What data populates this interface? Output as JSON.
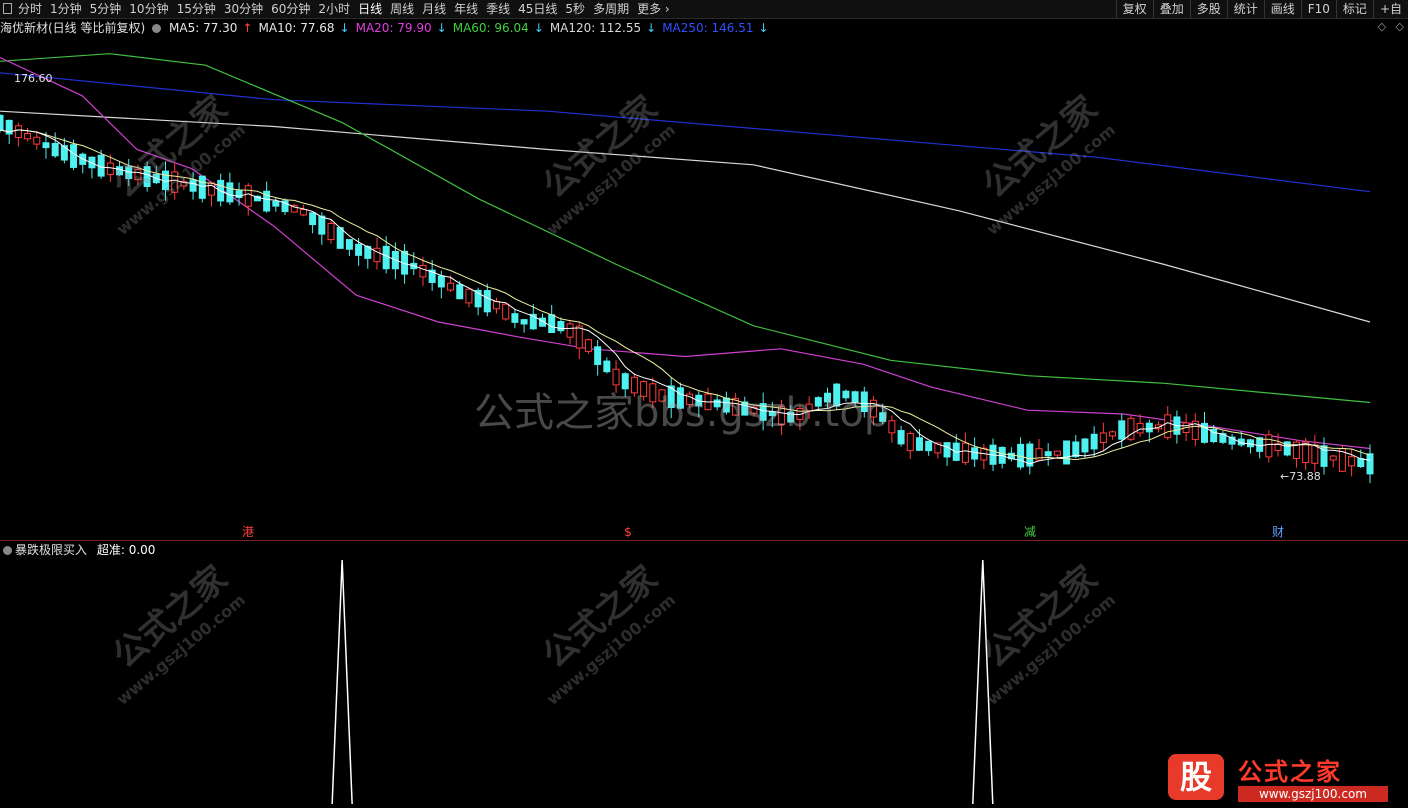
{
  "toolbar": {
    "periods": [
      "分时",
      "1分钟",
      "5分钟",
      "10分钟",
      "15分钟",
      "30分钟",
      "60分钟",
      "2小时",
      "日线",
      "周线",
      "月线",
      "年线",
      "季线",
      "45日线",
      "5秒",
      "多周期",
      "更多"
    ],
    "active": "日线",
    "right_buttons": [
      "复权",
      "叠加",
      "多股",
      "统计",
      "画线",
      "F10",
      "标记",
      "+自"
    ]
  },
  "legend": {
    "title": "海优新材(日线 等比前复权)",
    "ma": [
      {
        "label": "MA5: 77.30",
        "arrow": "↑",
        "color": "#e8e8e8",
        "arrow_color": "#ff4040"
      },
      {
        "label": "MA10: 77.68",
        "arrow": "↓",
        "color": "#e8e8e8",
        "arrow_color": "#40d0ff"
      },
      {
        "label": "MA20: 79.90",
        "arrow": "↓",
        "color": "#e040e0",
        "arrow_color": "#40d0ff"
      },
      {
        "label": "MA60: 96.04",
        "arrow": "↓",
        "color": "#40d040",
        "arrow_color": "#40d0ff"
      },
      {
        "label": "MA120: 112.55",
        "arrow": "↓",
        "color": "#d8d8d8",
        "arrow_color": "#40d0ff"
      },
      {
        "label": "MA250: 146.51",
        "arrow": "↓",
        "color": "#3050ff",
        "arrow_color": "#40d0ff"
      }
    ],
    "right_icons": [
      "◇",
      "◇"
    ]
  },
  "price_labels": {
    "high": "176.60",
    "low": "←73.88"
  },
  "event_markers": [
    {
      "text": "港",
      "color": "#ff4040"
    },
    {
      "text": "$",
      "color": "#ff4040"
    },
    {
      "text": "减",
      "color": "#40d040"
    },
    {
      "text": "财",
      "color": "#60a0ff"
    }
  ],
  "indicator": {
    "name": "暴跌极限买入",
    "value_label": "超准: 0.00",
    "signals": [
      {
        "bar_index": 0.243
      },
      {
        "bar_index": 0.698
      }
    ]
  },
  "watermarks": {
    "small_title": "公式之家",
    "small_url": "www.gszj100.com",
    "center": "公式之家bbs.gszb.top"
  },
  "logo": {
    "badge": "股",
    "title": "公式之家",
    "url": "www.gszj100.com"
  },
  "chart_data": {
    "type": "candlestick",
    "y_range": [
      73.88,
      176.6
    ],
    "candle_points": [
      [
        0,
        165
      ],
      [
        4,
        158
      ],
      [
        8,
        153
      ],
      [
        12,
        150
      ],
      [
        15,
        148
      ],
      [
        18,
        146
      ],
      [
        22,
        142
      ],
      [
        26,
        132
      ],
      [
        30,
        128
      ],
      [
        34,
        120
      ],
      [
        36,
        118
      ],
      [
        40,
        108
      ],
      [
        44,
        100
      ],
      [
        48,
        94
      ],
      [
        52,
        92
      ],
      [
        55,
        90
      ],
      [
        58,
        88
      ],
      [
        62,
        86
      ],
      [
        66,
        82
      ],
      [
        70,
        79
      ],
      [
        74,
        78
      ],
      [
        78,
        79
      ],
      [
        82,
        85
      ],
      [
        86,
        86
      ],
      [
        90,
        82
      ],
      [
        94,
        80
      ],
      [
        98,
        77
      ],
      [
        100,
        76
      ]
    ],
    "series": {
      "ma5_end": 77.3,
      "ma10_end": 77.68,
      "ma20_end": 79.9,
      "ma60_end": 96.04,
      "ma120_end": 112.55,
      "ma250_end": 146.51
    }
  }
}
